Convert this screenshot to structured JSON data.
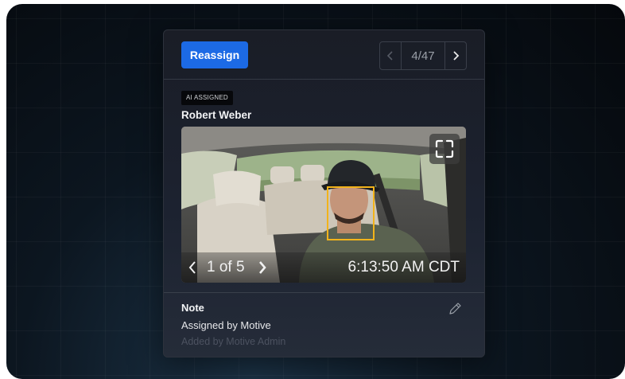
{
  "header": {
    "reassign_label": "Reassign",
    "pager": {
      "count": "4/47"
    }
  },
  "event": {
    "badge": "AI ASSIGNED",
    "driver_name": "Robert Weber"
  },
  "video": {
    "counter": "1 of 5",
    "timestamp": "6:13:50 AM CDT",
    "prev_glyph": "<",
    "next_glyph": ">"
  },
  "note": {
    "title": "Note",
    "text": "Assigned by Motive",
    "sub": "Added by Motive Admin"
  },
  "colors": {
    "accent": "#1c6ae5",
    "face_box": "#f2b31b"
  },
  "icons": {
    "pager_prev": "chevron-left-icon",
    "pager_next": "chevron-right-icon",
    "fullscreen": "fullscreen-icon",
    "edit": "pencil-icon"
  }
}
